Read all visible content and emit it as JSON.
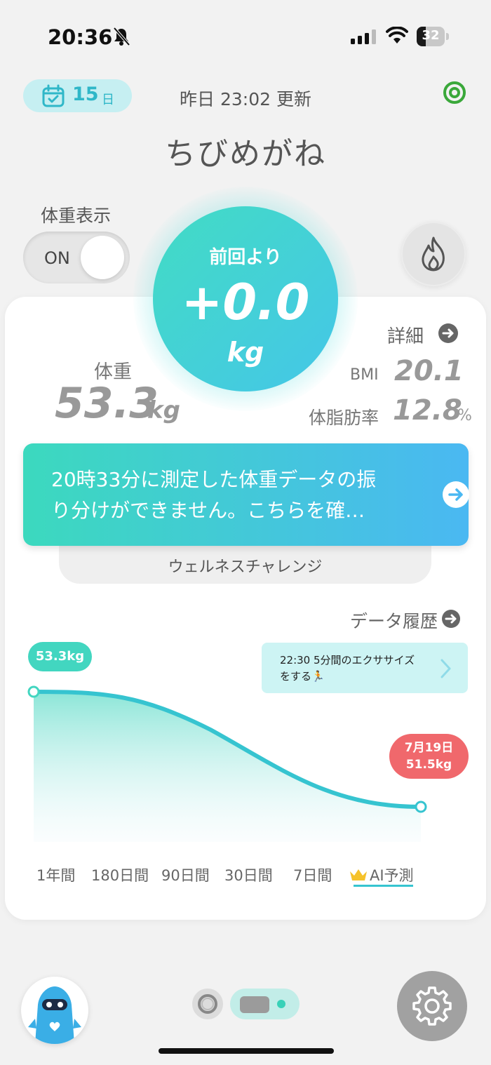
{
  "status_bar": {
    "time": "20:36",
    "battery": "32",
    "battery_level": 0.32
  },
  "header": {
    "streak_days": "15",
    "streak_unit": "日",
    "updated": "昨日 23:02 更新",
    "username": "ちびめがね"
  },
  "toggle": {
    "label": "体重表示",
    "state": "ON"
  },
  "change": {
    "title": "前回より",
    "value": "+0.0",
    "unit": "kg"
  },
  "weight": {
    "label": "体重",
    "value": "53.3",
    "unit": "kg"
  },
  "details": {
    "label": "詳細",
    "bmi_label": "BMI",
    "bmi_value": "20.1",
    "fat_label": "体脂肪率",
    "fat_value": "12.8",
    "fat_unit": "%"
  },
  "banner": {
    "text": "20時33分に測定した体重データの振\nり分けができません。こちらを確…"
  },
  "challenge": {
    "label": "ウェルネスチャレンジ"
  },
  "history": {
    "label": "データ履歴"
  },
  "chart": {
    "start_label": "53.3kg",
    "end_date": "7月19日",
    "end_label": "51.5kg",
    "tip": "22:30 5分間のエクササイズ\nをする🏃",
    "ranges": [
      "1年間",
      "180日間",
      "90日間",
      "30日間",
      "7日間",
      "AI予測"
    ],
    "selected_range": "AI予測",
    "accent_color": "#36c4d0"
  },
  "colors": {
    "gradient_start": "#3cd9be",
    "gradient_end": "#4ab8f2",
    "end_badge": "#f0686c"
  }
}
